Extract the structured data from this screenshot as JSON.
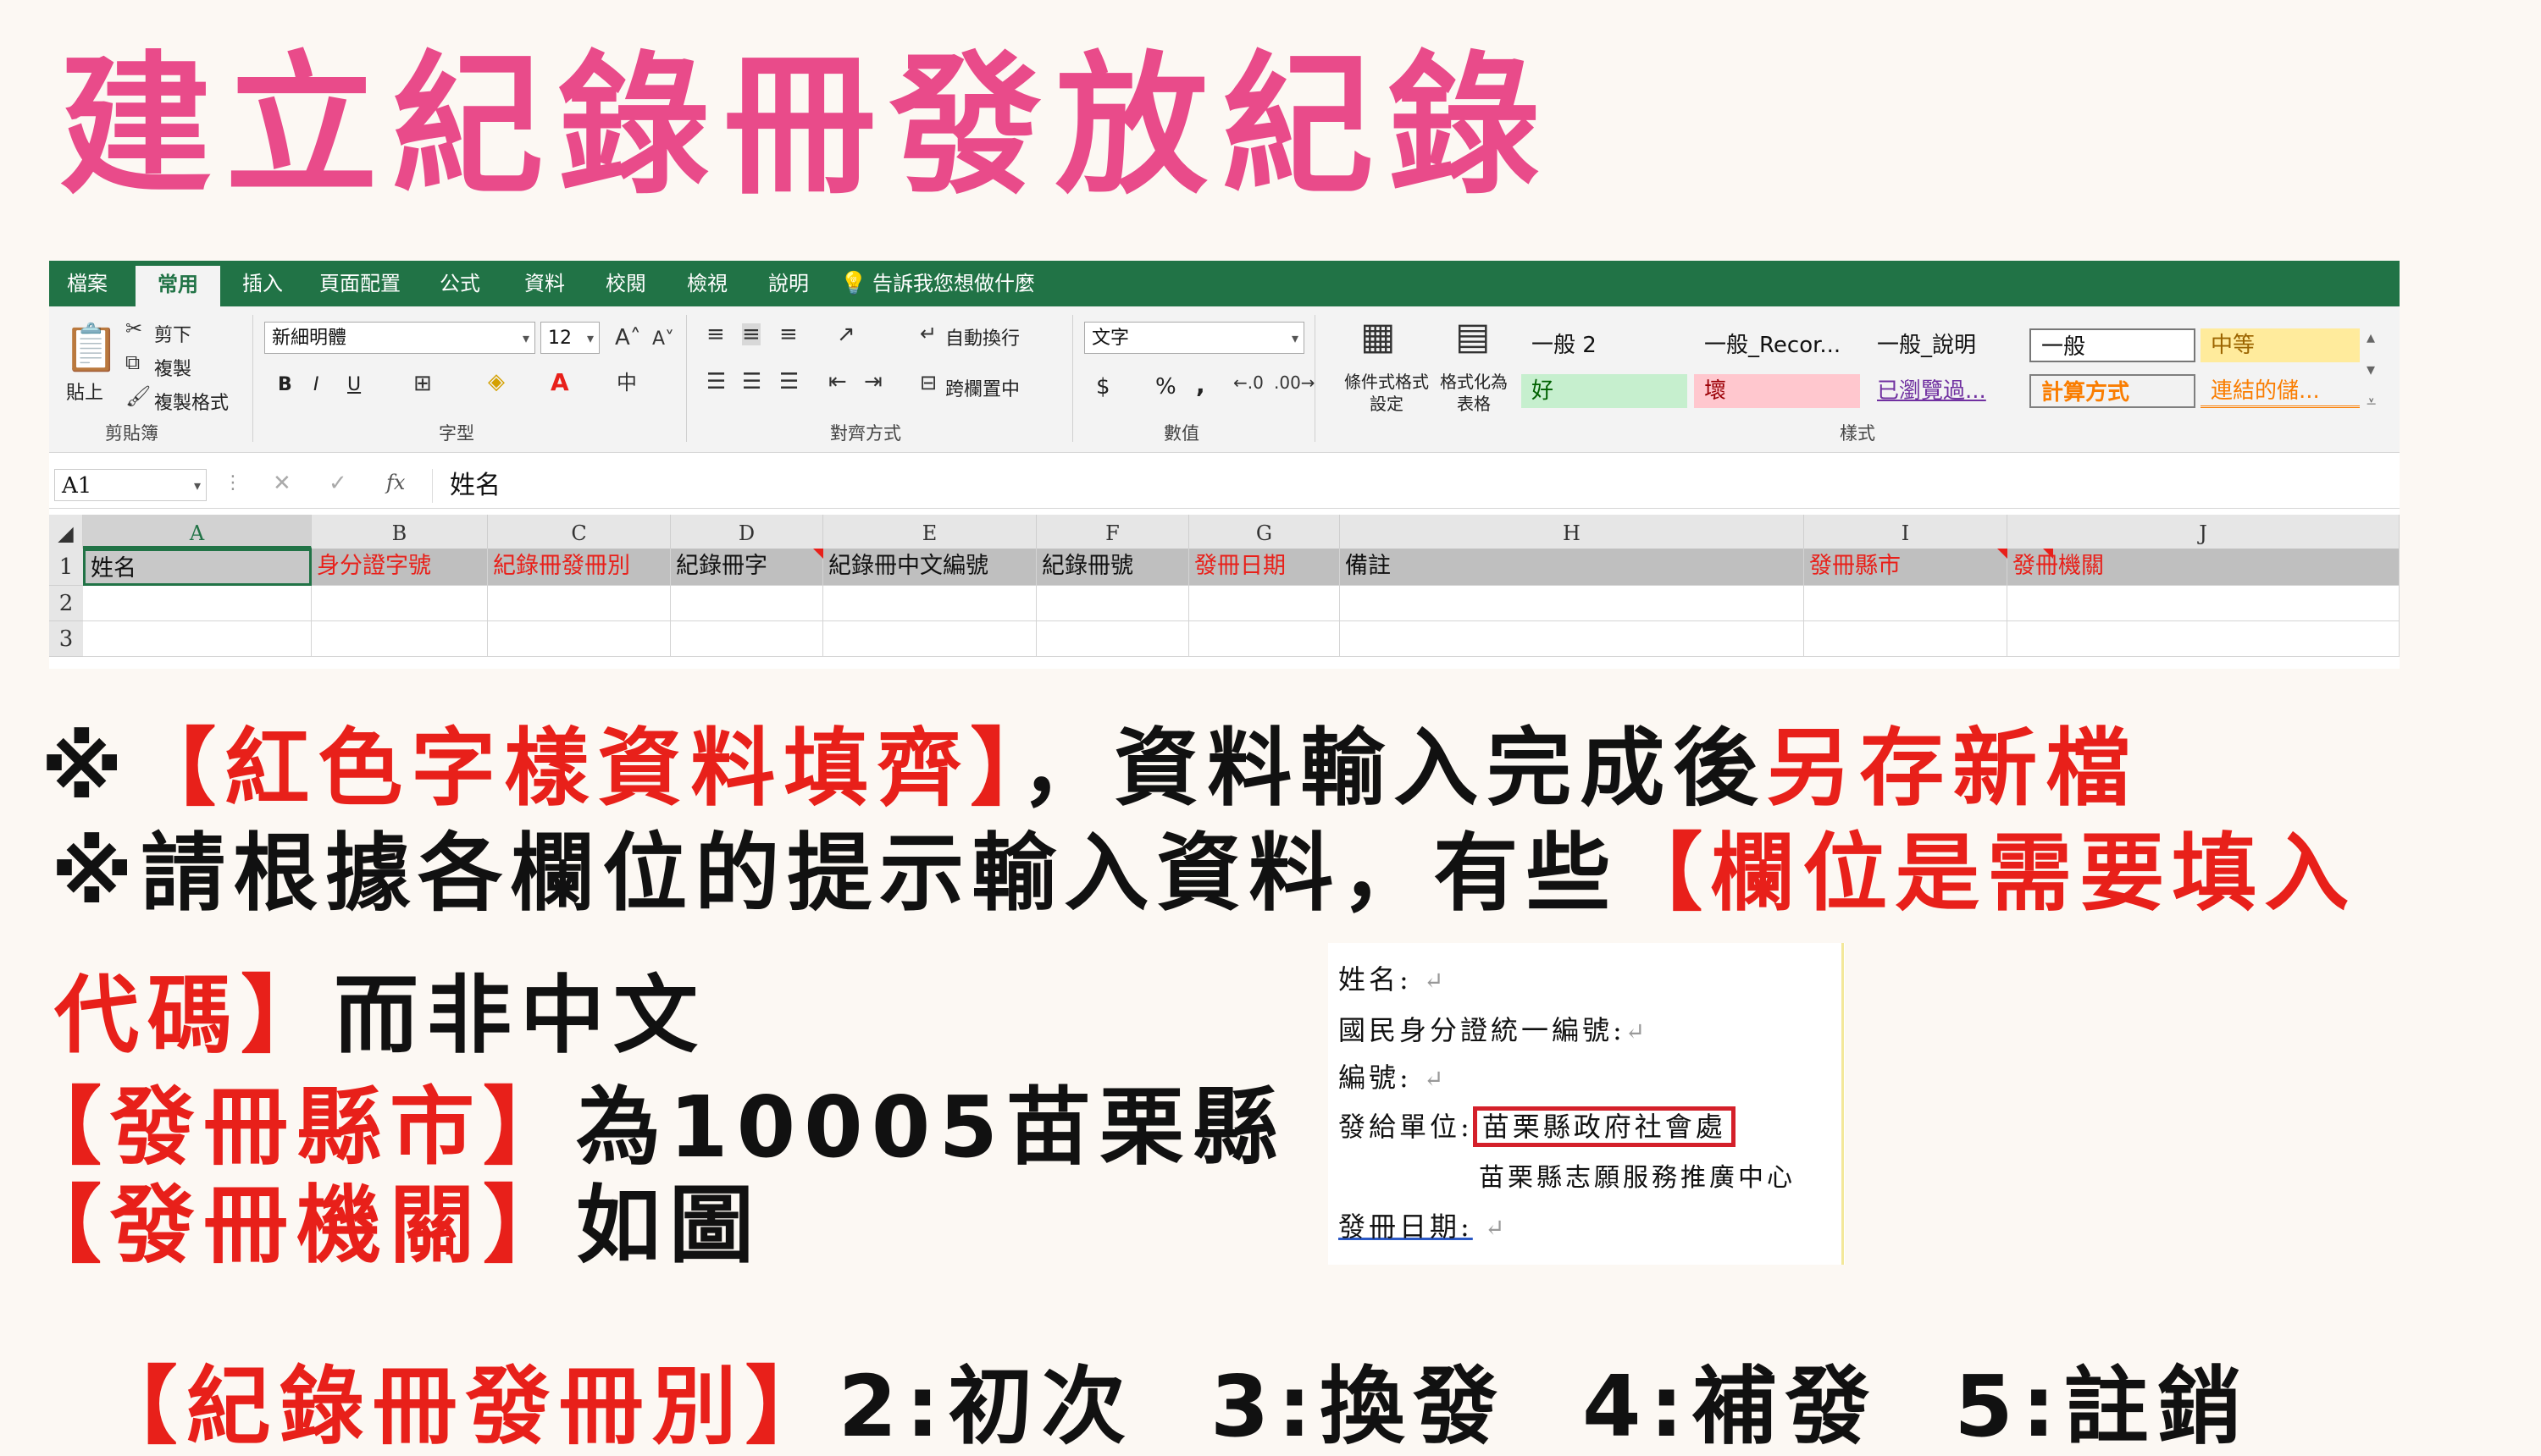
{
  "title": "建立紀錄冊發放紀錄",
  "excel": {
    "tabs": [
      "檔案",
      "常用",
      "插入",
      "頁面配置",
      "公式",
      "資料",
      "校閱",
      "檢視",
      "說明",
      "告訴我您想做什麼"
    ],
    "clipboard": {
      "paste": "貼上",
      "cut": "剪下",
      "copy": "複製",
      "format_painter": "複製格式",
      "label": "剪貼簿"
    },
    "font": {
      "name": "新細明體",
      "size": "12",
      "bold": "B",
      "italic": "I",
      "underline": "U",
      "label": "字型"
    },
    "alignment": {
      "wrap": "自動換行",
      "merge": "跨欄置中",
      "label": "對齊方式"
    },
    "number": {
      "format": "文字",
      "currency": "$",
      "percent": "%",
      "comma": ",",
      "label": "數值"
    },
    "styles_group": {
      "conditional": "條件式格式設定",
      "table": "格式化為表格",
      "label": "樣式"
    },
    "styles": [
      {
        "name": "一般 2",
        "bg": "#ffffff",
        "color": "#222222"
      },
      {
        "name": "一般_Recor...",
        "bg": "#ffffff",
        "color": "#222222"
      },
      {
        "name": "一般_說明",
        "bg": "#ffffff",
        "color": "#222222"
      },
      {
        "name": "一般",
        "bg": "#ffffff",
        "color": "#222222"
      },
      {
        "name": "中等",
        "bg": "#ffeb9c",
        "color": "#9c6500"
      },
      {
        "name": "好",
        "bg": "#c6efce",
        "color": "#006100"
      },
      {
        "name": "壞",
        "bg": "#ffc7ce",
        "color": "#9c0006"
      },
      {
        "name": "已瀏覽過...",
        "bg": "#ffffff",
        "color": "#7030a0"
      },
      {
        "name": "計算方式",
        "bg": "#f2f2f2",
        "color": "#fa7d00"
      },
      {
        "name": "連結的儲...",
        "bg": "#ffffff",
        "color": "#fa7d00"
      }
    ],
    "name_box": "A1",
    "formula": "姓名",
    "fx": "fx",
    "columns": [
      "A",
      "B",
      "C",
      "D",
      "E",
      "F",
      "G",
      "H",
      "I",
      "J"
    ],
    "rows": [
      "1",
      "2",
      "3"
    ],
    "header_cells": [
      {
        "text": "姓名",
        "red": false
      },
      {
        "text": "身分證字號",
        "red": true
      },
      {
        "text": "紀錄冊發冊別",
        "red": true
      },
      {
        "text": "紀錄冊字",
        "red": false
      },
      {
        "text": "紀錄冊中文編號",
        "red": false
      },
      {
        "text": "紀錄冊號",
        "red": false
      },
      {
        "text": "發冊日期",
        "red": true
      },
      {
        "text": "備註",
        "red": false
      },
      {
        "text": "發冊縣市",
        "red": true
      },
      {
        "text": "發冊機關",
        "red": true
      }
    ]
  },
  "notes": {
    "line1_prefix": "※",
    "line1_red": "【紅色字樣資料填齊】",
    "line1_mid": "，資料輸入完成後",
    "line1_red2": "另存新檔",
    "line2_prefix": "※請根據各欄位的提示輸入資料，有些",
    "line2_red": "【欄位是需要填入",
    "line3_red": "代碼】",
    "line3_text": "而非中文",
    "line4_red": "【發冊縣市】",
    "line4_text": "為10005苗栗縣",
    "line5_red": "【發冊機關】",
    "line5_text": "如圖",
    "line6_red": "【紀錄冊發冊別】",
    "line6_text": "2:初次  3:換發  4:補發  5:註銷"
  },
  "form": {
    "name_label": "姓名:",
    "id_label": "國民身分證統一編號:",
    "number_label": "編號:",
    "unit_label": "發給單位:",
    "unit_value": "苗栗縣政府社會處",
    "unit_value2": "苗栗縣志願服務推廣中心",
    "date_label": "發冊日期:",
    "return_mark": "↵"
  }
}
